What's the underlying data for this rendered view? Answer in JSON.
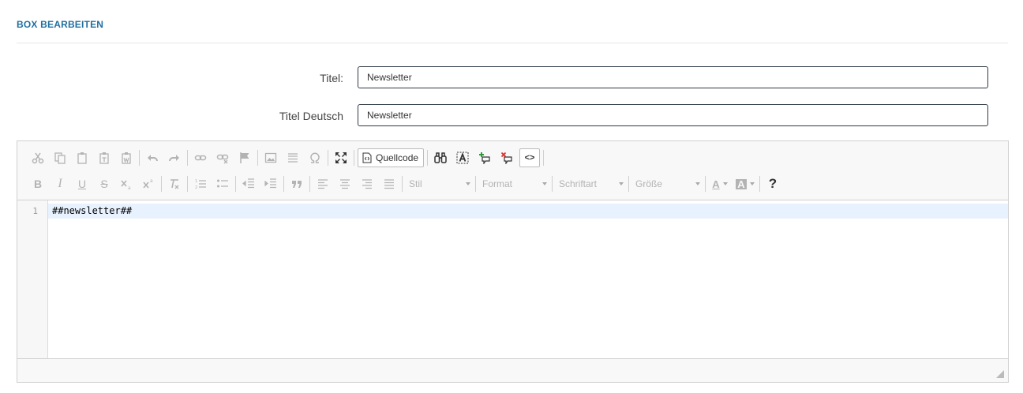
{
  "header": {
    "title": "BOX BEARBEITEN"
  },
  "form": {
    "title_label": "Titel:",
    "title_value": "Newsletter",
    "title_de_label": "Titel Deutsch",
    "title_de_value": "Newsletter"
  },
  "editor": {
    "toolbar": {
      "source_label": "Quellcode",
      "tag_label": "<>",
      "style_label": "Stil",
      "format_label": "Format",
      "font_label": "Schriftart",
      "size_label": "Größe",
      "help_label": "?",
      "bold_label": "B",
      "italic_label": "I",
      "underline_label": "U",
      "strike_label": "S",
      "color_label": "A"
    },
    "lines": [
      {
        "number": "1",
        "text": "##newsletter##"
      }
    ]
  }
}
